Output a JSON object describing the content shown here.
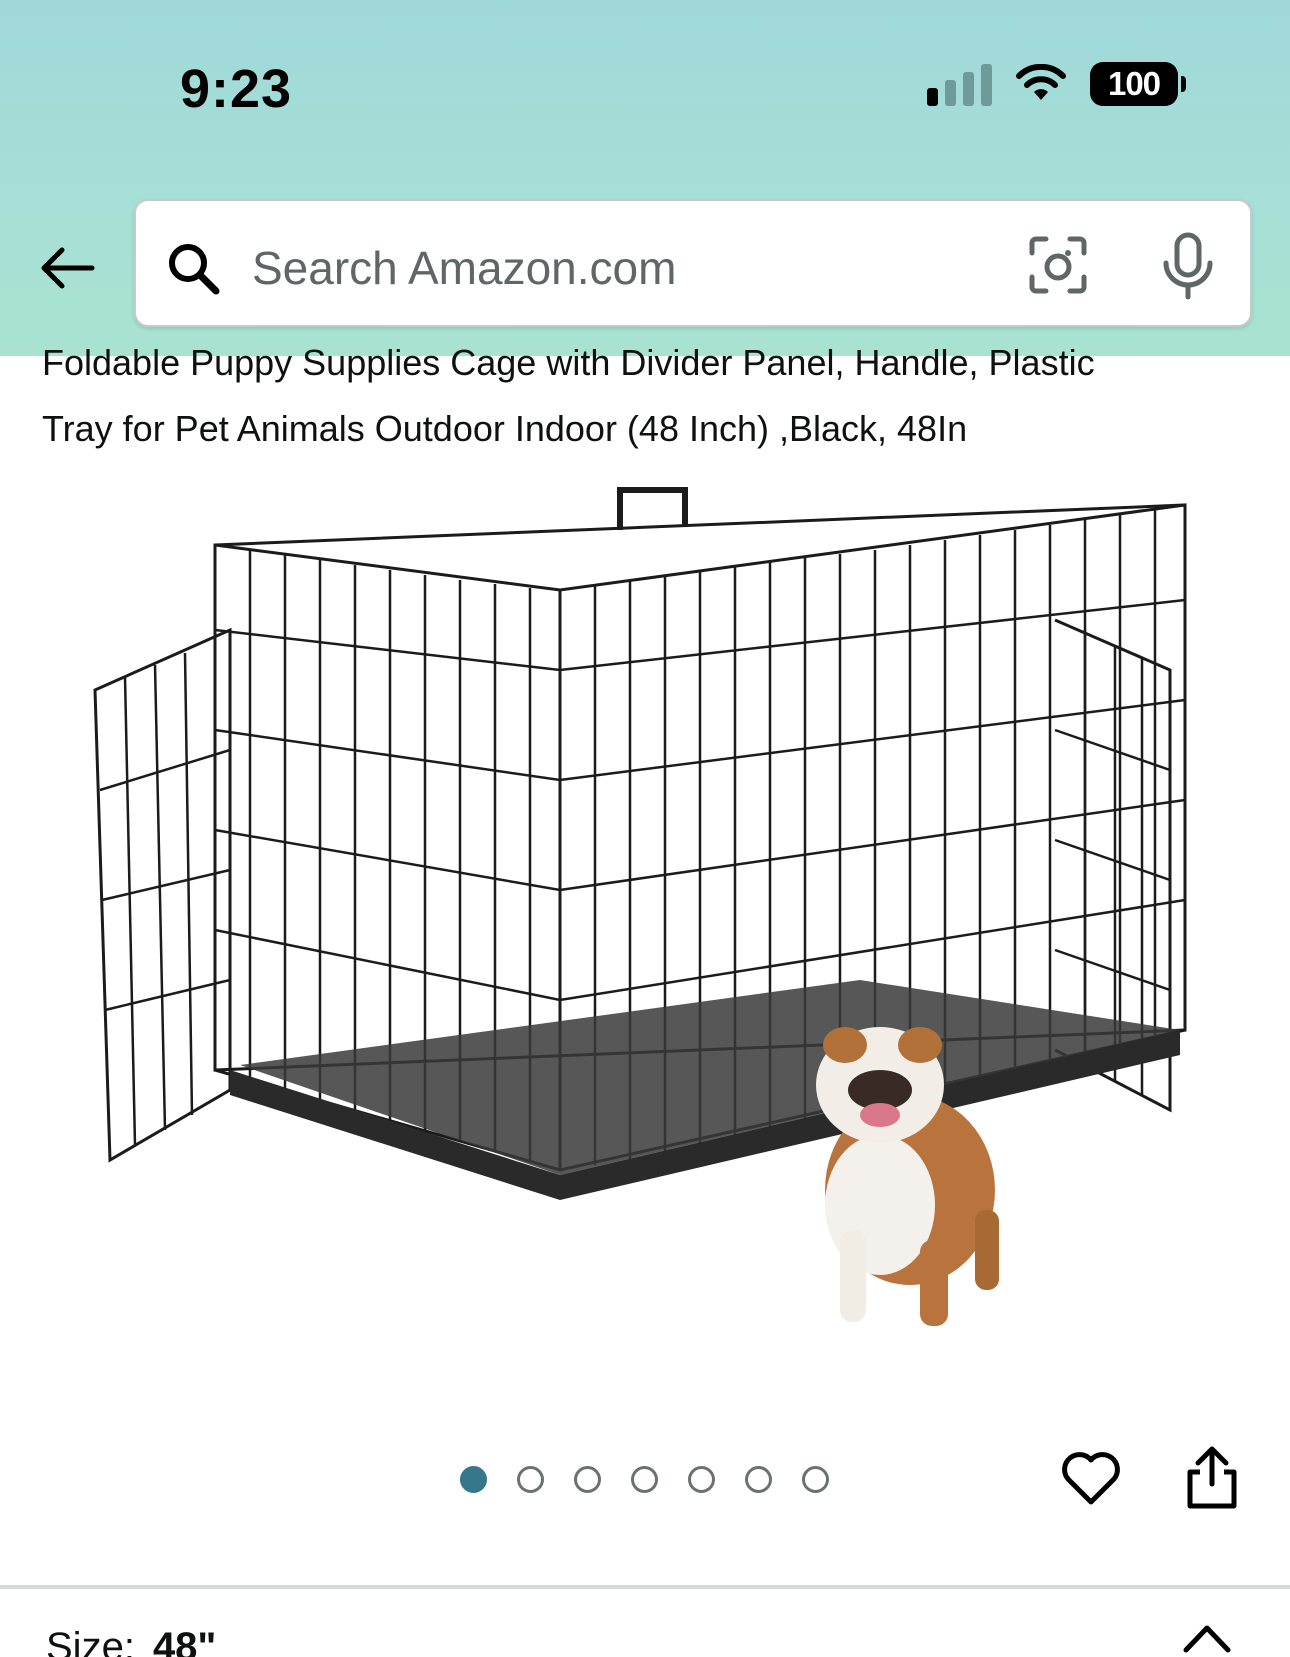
{
  "status_bar": {
    "time": "9:23",
    "battery": "100"
  },
  "search": {
    "placeholder": "Search Amazon.com"
  },
  "product": {
    "title_line1": "Foldable Puppy Supplies Cage with Divider Panel, Handle, Plastic",
    "title_line2": "Tray for Pet Animals Outdoor Indoor (48 Inch) ,Black, 48In",
    "image_count": 7,
    "active_image_index": 0
  },
  "options": {
    "size_label": "Size:",
    "size_value": "48\""
  },
  "colors": {
    "header_top": "#9fd8d9",
    "header_bottom": "#a9e3d0",
    "active_dot": "#36788a"
  },
  "icons": [
    "back-arrow-icon",
    "search-icon",
    "camera-icon",
    "microphone-icon",
    "heart-icon",
    "share-icon",
    "chevron-up-icon"
  ]
}
